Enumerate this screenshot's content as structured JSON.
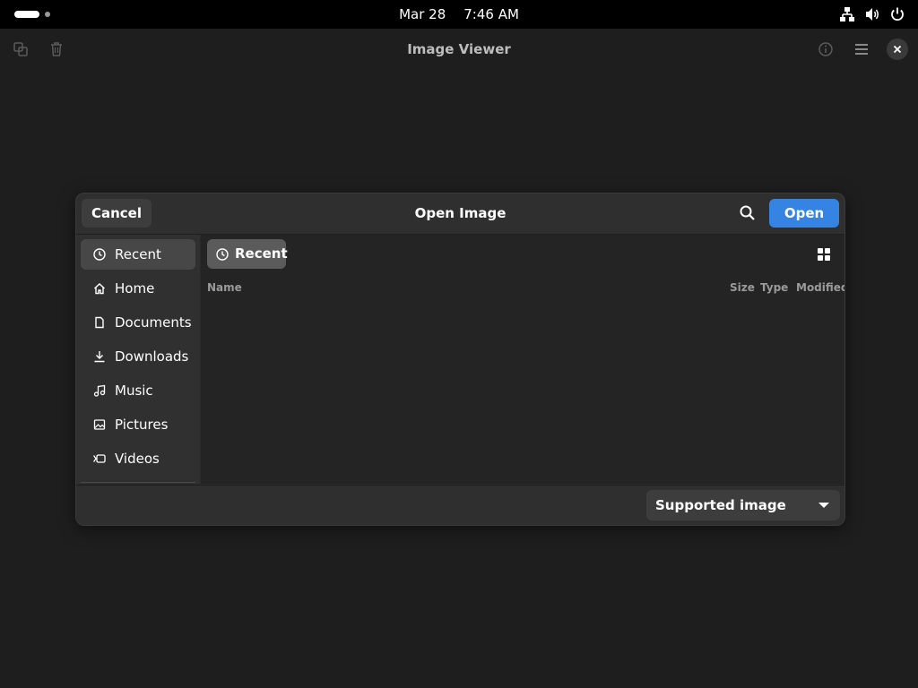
{
  "topbar": {
    "date": "Mar 28",
    "time": "7:46 AM",
    "icons": [
      "network-icon",
      "volume-icon",
      "power-icon"
    ]
  },
  "app": {
    "title": "Image Viewer",
    "left_icons": [
      "copy-icon",
      "trash-icon"
    ],
    "right_icons": [
      "info-icon",
      "menu-icon",
      "close-icon"
    ]
  },
  "dialog": {
    "title": "Open Image",
    "cancel_label": "Cancel",
    "open_label": "Open",
    "accent": "#3584e4",
    "sidebar": {
      "items": [
        {
          "label": "Recent",
          "icon": "clock-icon",
          "active": true
        },
        {
          "label": "Home",
          "icon": "home-icon"
        },
        {
          "label": "Documents",
          "icon": "document-icon"
        },
        {
          "label": "Downloads",
          "icon": "download-icon"
        },
        {
          "label": "Music",
          "icon": "music-icon"
        },
        {
          "label": "Pictures",
          "icon": "picture-icon"
        },
        {
          "label": "Videos",
          "icon": "video-icon"
        }
      ]
    },
    "location": "Recent",
    "columns": [
      "Name",
      "Size",
      "Type",
      "Modified"
    ],
    "filter": "Supported image formats"
  }
}
